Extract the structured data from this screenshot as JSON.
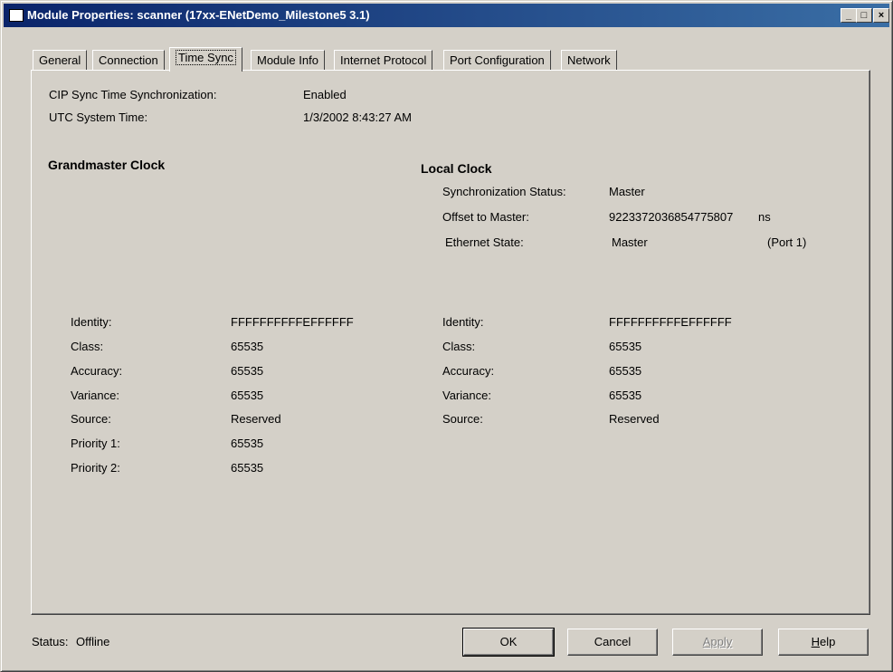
{
  "window": {
    "title": "Module Properties: scanner (17xx-ENetDemo_Milestone5 3.1)",
    "controls": {
      "minimize": "_",
      "maximize": "□",
      "close": "×"
    }
  },
  "tabs": [
    {
      "label": "General"
    },
    {
      "label": "Connection"
    },
    {
      "label": "Time Sync",
      "active": true
    },
    {
      "label": "Module Info"
    },
    {
      "label": "Internet Protocol"
    },
    {
      "label": "Port Configuration"
    },
    {
      "label": "Network"
    }
  ],
  "time_sync": {
    "cip_sync_label": "CIP Sync Time Synchronization:",
    "cip_sync_value": "Enabled",
    "utc_label": "UTC System Time:",
    "utc_value": "1/3/2002 8:43:27 AM"
  },
  "grandmaster": {
    "heading": "Grandmaster Clock",
    "rows": [
      {
        "label": "Identity:",
        "value": "FFFFFFFFFFEFFFFFF"
      },
      {
        "label": "Class:",
        "value": "65535"
      },
      {
        "label": "Accuracy:",
        "value": "65535"
      },
      {
        "label": "Variance:",
        "value": "65535"
      },
      {
        "label": "Source:",
        "value": "Reserved"
      },
      {
        "label": "Priority 1:",
        "value": "65535"
      },
      {
        "label": "Priority 2:",
        "value": "65535"
      }
    ]
  },
  "local": {
    "heading": "Local Clock",
    "sync_status_label": "Synchronization Status:",
    "sync_status_value": "Master",
    "offset_label": "Offset to Master:",
    "offset_value": "9223372036854775807",
    "offset_unit": "ns",
    "ethernet_label": "Ethernet State:",
    "ethernet_value": "Master",
    "ethernet_port": "(Port 1)",
    "rows": [
      {
        "label": "Identity:",
        "value": "FFFFFFFFFFEFFFFFF"
      },
      {
        "label": "Class:",
        "value": "65535"
      },
      {
        "label": "Accuracy:",
        "value": "65535"
      },
      {
        "label": "Variance:",
        "value": "65535"
      },
      {
        "label": "Source:",
        "value": "Reserved"
      }
    ]
  },
  "status": {
    "label": "Status:",
    "value": "Offline"
  },
  "buttons": {
    "ok": "OK",
    "cancel": "Cancel",
    "apply": "Apply",
    "help_first": "H",
    "help_rest": "elp"
  }
}
